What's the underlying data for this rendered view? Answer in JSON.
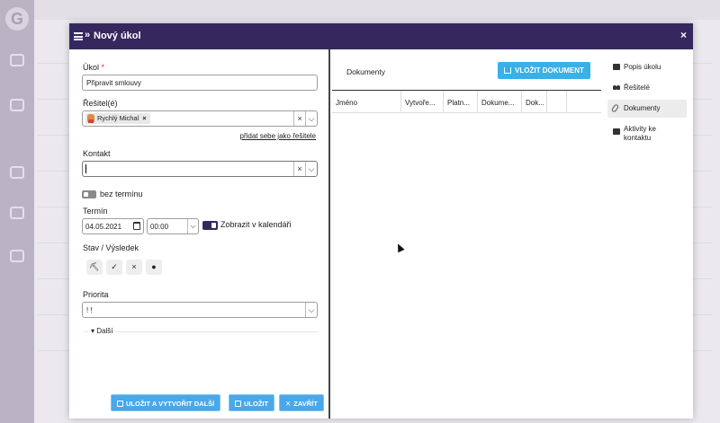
{
  "modal": {
    "title": "Nový úkol",
    "close": "×"
  },
  "form": {
    "ukol_label": "Úkol",
    "required_mark": "*",
    "ukol_value": "Připravit smlouvy",
    "resitel_label": "Řešitel(é)",
    "resitel_chip": "Rychlý Michal",
    "chip_remove": "×",
    "add_self_link": "přidat sebe jako řešitele",
    "kontakt_label": "Kontakt",
    "kontakt_value": "",
    "clear": "×",
    "caret": "⌵",
    "no_deadline_label": "bez termínu",
    "termin_label": "Termín",
    "date_value": "04.05.2021",
    "time_value": "00:00",
    "show_calendar_label": "Zobrazit v kalendáři",
    "stav_label": "Stav / Výsledek",
    "stav_buttons": [
      "⛏",
      "✓",
      "×",
      "●"
    ],
    "priorita_label": "Priorita",
    "priorita_value": "! !",
    "dalsi_label": "▾ Další"
  },
  "footer": {
    "save_and_new": "ULOŽIT A VYTVOŘIT DALŠÍ",
    "save": "ULOŽIT",
    "close": "ZAVŘÍT",
    "close_icon": "✕"
  },
  "documents": {
    "title": "Dokumenty",
    "insert_button": "VLOŽIT DOKUMENT",
    "columns": [
      "Jméno",
      "Vytvoře...",
      "Platn...",
      "Dokume...",
      "Dok..."
    ]
  },
  "right_nav": {
    "items": [
      {
        "label": "Popis úkolu"
      },
      {
        "label": "Řešitelé"
      },
      {
        "label": "Dokumenty"
      },
      {
        "label": "Aktivity ke kontaktu"
      }
    ]
  },
  "colors": {
    "header": "#37275f",
    "accent_button": "#4aa8e8"
  }
}
